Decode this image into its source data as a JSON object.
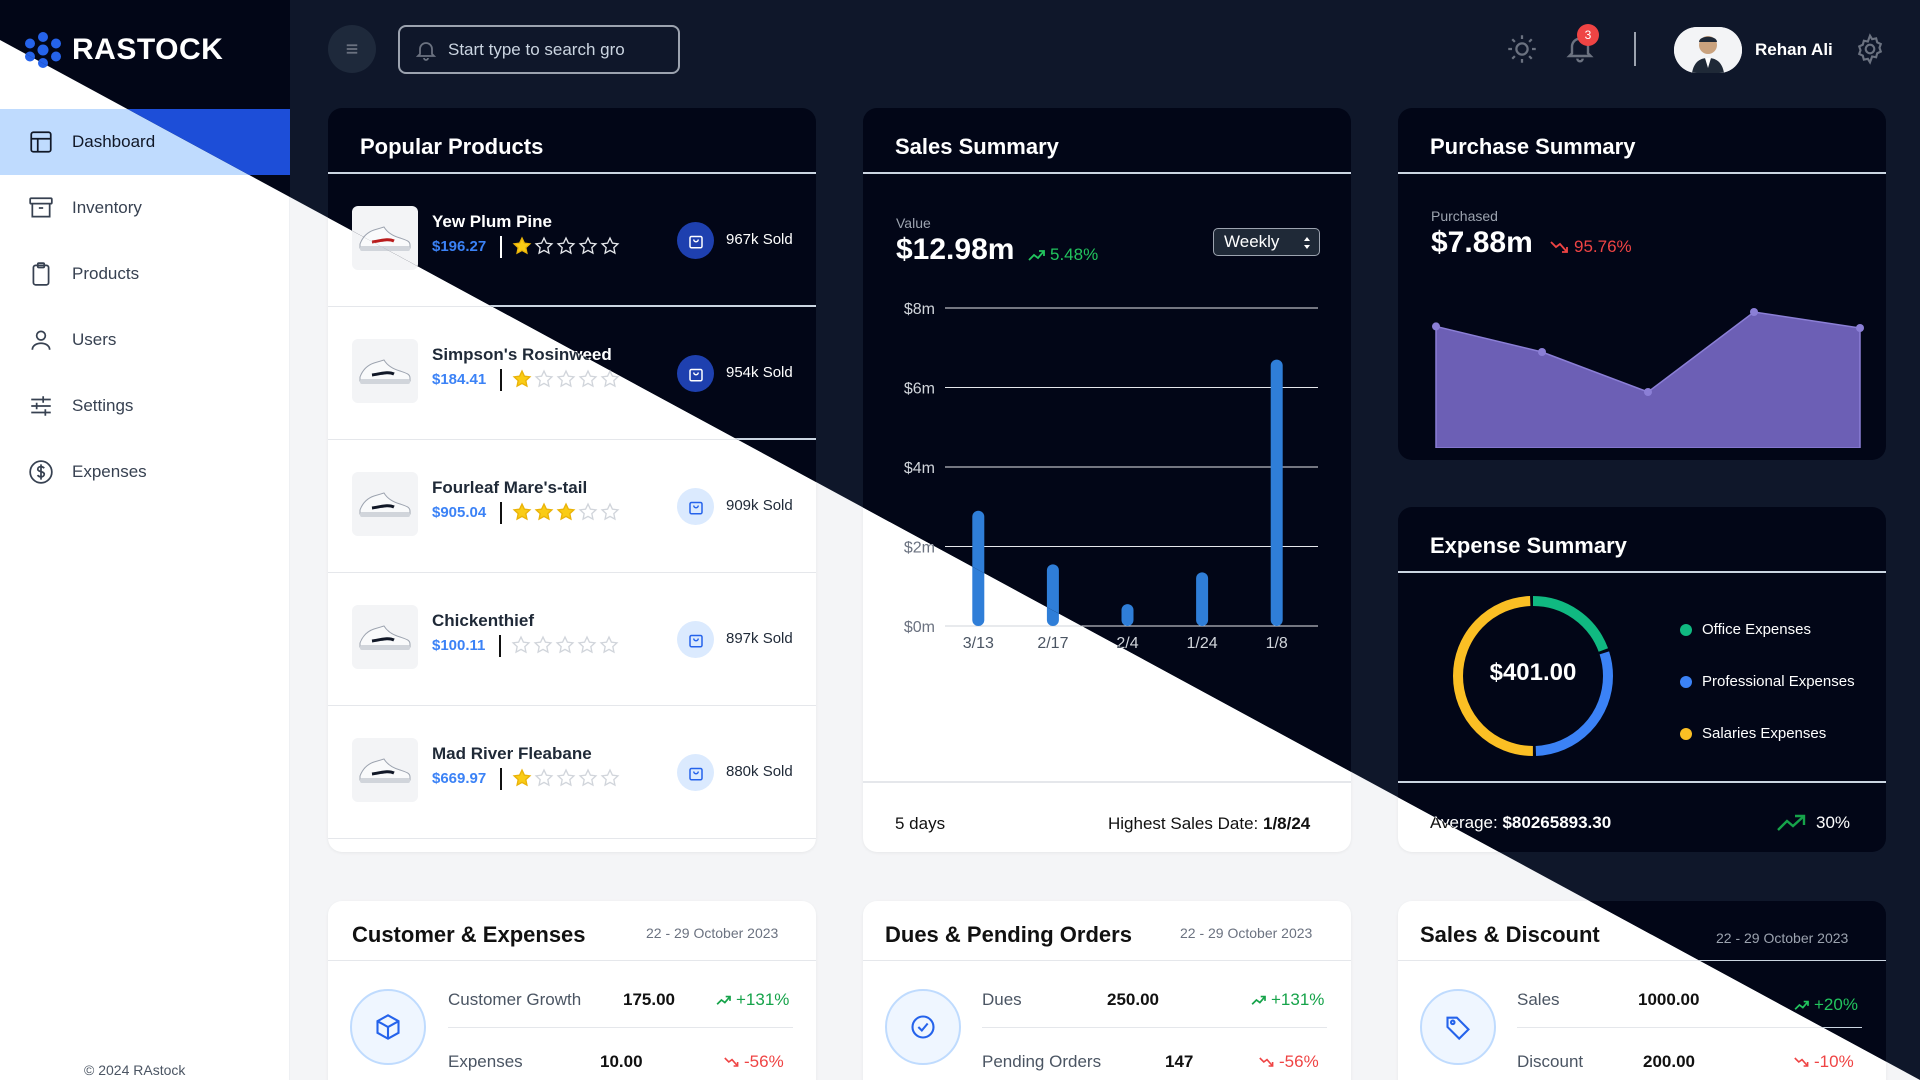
{
  "app": {
    "brand": "RASTOCK",
    "footer": "© 2024 RAstock"
  },
  "sidebar": {
    "items": [
      {
        "label": "Dashboard",
        "icon": "layout-icon",
        "active": true
      },
      {
        "label": "Inventory",
        "icon": "archive-icon"
      },
      {
        "label": "Products",
        "icon": "clipboard-icon"
      },
      {
        "label": "Users",
        "icon": "user-icon"
      },
      {
        "label": "Settings",
        "icon": "sliders-icon"
      },
      {
        "label": "Expenses",
        "icon": "dollar-circle-icon"
      }
    ]
  },
  "header": {
    "search_placeholder": "Start type to search gro",
    "notification_count": "3",
    "user_name": "Rehan Ali"
  },
  "popular_products": {
    "title": "Popular Products",
    "items": [
      {
        "name": "Yew Plum Pine",
        "price": "$196.27",
        "rating": 1,
        "sold": "967k Sold"
      },
      {
        "name": "Simpson's Rosinweed",
        "price": "$184.41",
        "rating": 1,
        "sold": "954k Sold"
      },
      {
        "name": "Fourleaf Mare's-tail",
        "price": "$905.04",
        "rating": 3,
        "sold": "909k Sold"
      },
      {
        "name": "Chickenthief",
        "price": "$100.11",
        "rating": 0,
        "sold": "897k Sold"
      },
      {
        "name": "Mad River Fleabane",
        "price": "$669.97",
        "rating": 1,
        "sold": "880k Sold"
      }
    ]
  },
  "sales_summary": {
    "title": "Sales Summary",
    "value_label": "Value",
    "value": "$12.98m",
    "change": "5.48%",
    "period": "Weekly",
    "days": "5 days",
    "highest_label": "Highest Sales Date:",
    "highest_date": "1/8/24"
  },
  "purchase_summary": {
    "title": "Purchase Summary",
    "label": "Purchased",
    "value": "$7.88m",
    "change": "95.76%"
  },
  "expense_summary": {
    "title": "Expense Summary",
    "total": "$401.00",
    "legend": [
      {
        "label": "Office Expenses",
        "color": "#10b981",
        "share": 0.2
      },
      {
        "label": "Professional Expenses",
        "color": "#3b82f6",
        "share": 0.3
      },
      {
        "label": "Salaries Expenses",
        "color": "#fbbf24",
        "share": 0.5
      }
    ],
    "average_label": "Average:",
    "average_value": "$80265893.30",
    "trend": "30%"
  },
  "customer_expenses": {
    "title": "Customer & Expenses",
    "range": "22 - 29 October 2023",
    "rows": [
      {
        "label": "Customer Growth",
        "value": "175.00",
        "change": "+131%",
        "dir": "up"
      },
      {
        "label": "Expenses",
        "value": "10.00",
        "change": "-56%",
        "dir": "down"
      }
    ]
  },
  "dues_pending": {
    "title": "Dues & Pending Orders",
    "range": "22 - 29 October 2023",
    "rows": [
      {
        "label": "Dues",
        "value": "250.00",
        "change": "+131%",
        "dir": "up"
      },
      {
        "label": "Pending Orders",
        "value": "147",
        "change": "-56%",
        "dir": "down"
      }
    ]
  },
  "sales_discount": {
    "title": "Sales & Discount",
    "range": "22 - 29 October 2023",
    "rows": [
      {
        "label": "Sales",
        "value": "1000.00",
        "change": "+20%",
        "dir": "up"
      },
      {
        "label": "Discount",
        "value": "200.00",
        "change": "-10%",
        "dir": "down"
      }
    ]
  },
  "chart_data": [
    {
      "type": "bar",
      "categories": [
        "3/13",
        "2/17",
        "2/4",
        "1/24",
        "1/8"
      ],
      "values": [
        2.9,
        1.55,
        0.55,
        1.35,
        6.7
      ],
      "yticks": [
        "$0m",
        "$2m",
        "$4m",
        "$6m",
        "$8m"
      ],
      "ylim": [
        0,
        8
      ],
      "color": "#2f7ed8"
    },
    {
      "type": "area",
      "values": [
        7.6,
        6.0,
        3.5,
        8.5,
        7.5
      ],
      "ylim": [
        0,
        10
      ],
      "color": "#6c5fb5"
    }
  ]
}
